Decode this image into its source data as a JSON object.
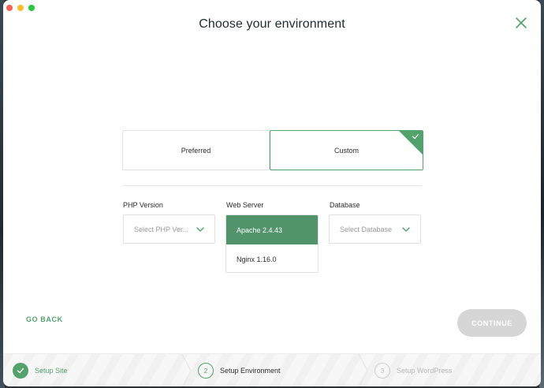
{
  "window": {
    "title": "Choose your environment"
  },
  "environment_options": [
    {
      "label": "Preferred",
      "selected": false
    },
    {
      "label": "Custom",
      "selected": true
    }
  ],
  "fields": {
    "php": {
      "label": "PHP Version",
      "placeholder": "Select PHP Ver..."
    },
    "web_server": {
      "label": "Web Server",
      "options": [
        "Apache 2.4.43",
        "Nginx 1.16.0"
      ],
      "highlighted": "Apache 2.4.43"
    },
    "database": {
      "label": "Database",
      "placeholder": "Select Database"
    }
  },
  "actions": {
    "go_back": "GO BACK",
    "continue": "CONTINUE"
  },
  "steps": [
    {
      "number": "1",
      "label": "Setup Site",
      "state": "done"
    },
    {
      "number": "2",
      "label": "Setup Environment",
      "state": "current"
    },
    {
      "number": "3",
      "label": "Setup WordPress",
      "state": "todo"
    }
  ],
  "colors": {
    "accent": "#51a26b",
    "dropdown_highlight": "#51936a",
    "continue_disabled": "#d6d6d6"
  },
  "icons": [
    "close-icon",
    "checkmark-icon",
    "chevron-down-icon"
  ]
}
